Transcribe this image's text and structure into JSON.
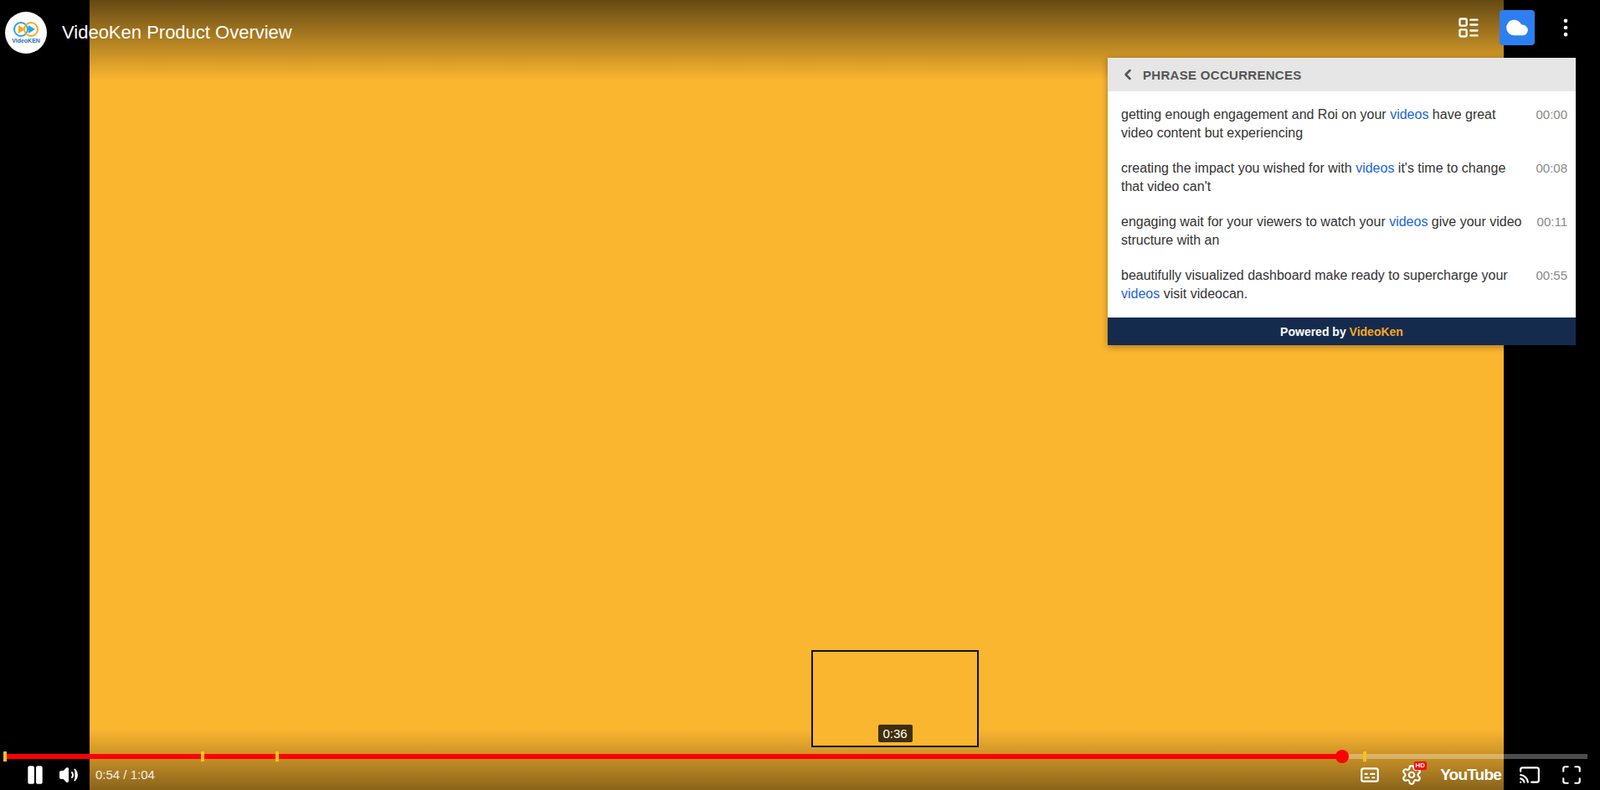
{
  "video": {
    "title": "VideoKen Product Overview",
    "logo": "VideoKEN"
  },
  "top_actions": [
    {
      "name": "chapters",
      "selected": false
    },
    {
      "name": "phrase-search",
      "selected": true
    },
    {
      "name": "more",
      "selected": false
    }
  ],
  "panel": {
    "title": "PHRASE OCCURRENCES",
    "rows": [
      {
        "before": "getting enough engagement and Roi on your ",
        "match": "videos",
        "after": " have great video content but experiencing",
        "time": "00:00"
      },
      {
        "before": "creating the impact you wished for with ",
        "match": "videos",
        "after": " it's time to change that video can't",
        "time": "00:08"
      },
      {
        "before": "engaging wait for your viewers to watch your ",
        "match": "videos",
        "after": " give your video structure with an",
        "time": "00:11"
      },
      {
        "before": "beautifully visualized dashboard make ready to supercharge your ",
        "match": "videos",
        "after": " visit videocan.",
        "time": "00:55"
      }
    ],
    "footer": {
      "prefix": "Powered by ",
      "brand": "VideoKen"
    }
  },
  "player": {
    "current": "0:54",
    "separator": " / ",
    "duration": "1:04",
    "level": 0.845,
    "paused": false,
    "muted": false,
    "preview": {
      "time": "0:36",
      "level": 0.5625
    },
    "hd_badge": "HD",
    "brand": "YouTube"
  }
}
